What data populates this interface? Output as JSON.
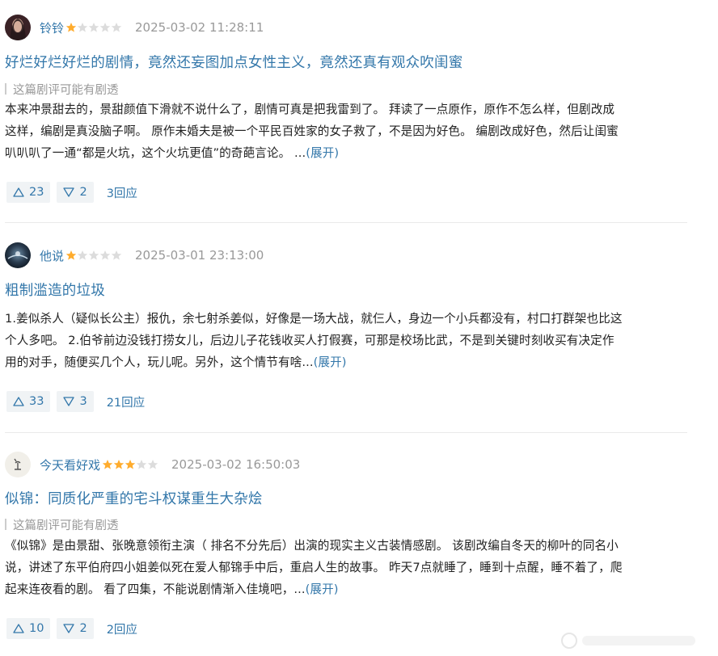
{
  "reviews": [
    {
      "author": "铃铃",
      "rating": 1,
      "date": "2025-03-02 11:28:11",
      "title": "好烂好烂好烂的剧情，竟然还妄图加点女性主义，竟然还真有观众吹闺蜜",
      "spoiler": "这篇剧评可能有剧透",
      "body": [
        "本来冲景甜去的，景甜颜值下滑就不说什么了，剧情可真是把我雷到了。 拜读了一点原作，原作不怎么样，但剧改成",
        "这样，编剧是真没脑子啊。 原作未婚夫是被一个平民百姓家的女子救了，不是因为好色。 编剧改成好色，然后让闺蜜",
        "叭叭叭了一通“都是火坑，这个火坑更值”的奇葩言论。 ..."
      ],
      "expand": "(展开)",
      "useful": "23",
      "useless": "2",
      "replies": "3回应"
    },
    {
      "author": "他说",
      "rating": 1,
      "date": "2025-03-01 23:13:00",
      "title": "粗制滥造的垃圾",
      "spoiler": "",
      "body": [
        "1.姜似杀人（疑似长公主）报仇，余七射杀姜似，好像是一场大战，就仨人，身边一个小兵都没有，村口打群架也比这",
        "个人多吧。 2.伯爷前边没钱打捞女儿，后边儿子花钱收买人打假赛，可那是校场比武，不是到关键时刻收买有决定作",
        "用的对手，随便买几个人，玩儿呢。另外，这个情节有啥..."
      ],
      "expand": "(展开)",
      "useful": "33",
      "useless": "3",
      "replies": "21回应"
    },
    {
      "author": "今天看好戏",
      "rating": 3,
      "date": "2025-03-02 16:50:03",
      "title": "似锦：同质化严重的宅斗权谋重生大杂烩",
      "spoiler": "这篇剧评可能有剧透",
      "body": [
        "《似锦》是由景甜、张晚意领衔主演（ 排名不分先后）出演的现实主义古装情感剧。 该剧改编自冬天的柳叶的同名小",
        "说，讲述了东平伯府四小姐姜似死在爱人郁锦手中后，重启人生的故事。 昨天7点就睡了，睡到十点醒，睡不着了，爬",
        "起来连夜看的剧。 看了四集，不能说剧情渐入佳境吧，..."
      ],
      "expand": "(展开)",
      "useful": "10",
      "useless": "2",
      "replies": "2回应"
    }
  ],
  "colors": {
    "link": "#3377aa",
    "star_filled": "#ffac2d",
    "star_empty": "#dcdcdc",
    "meta": "#999999",
    "vote_bg": "#f0f3f5"
  }
}
